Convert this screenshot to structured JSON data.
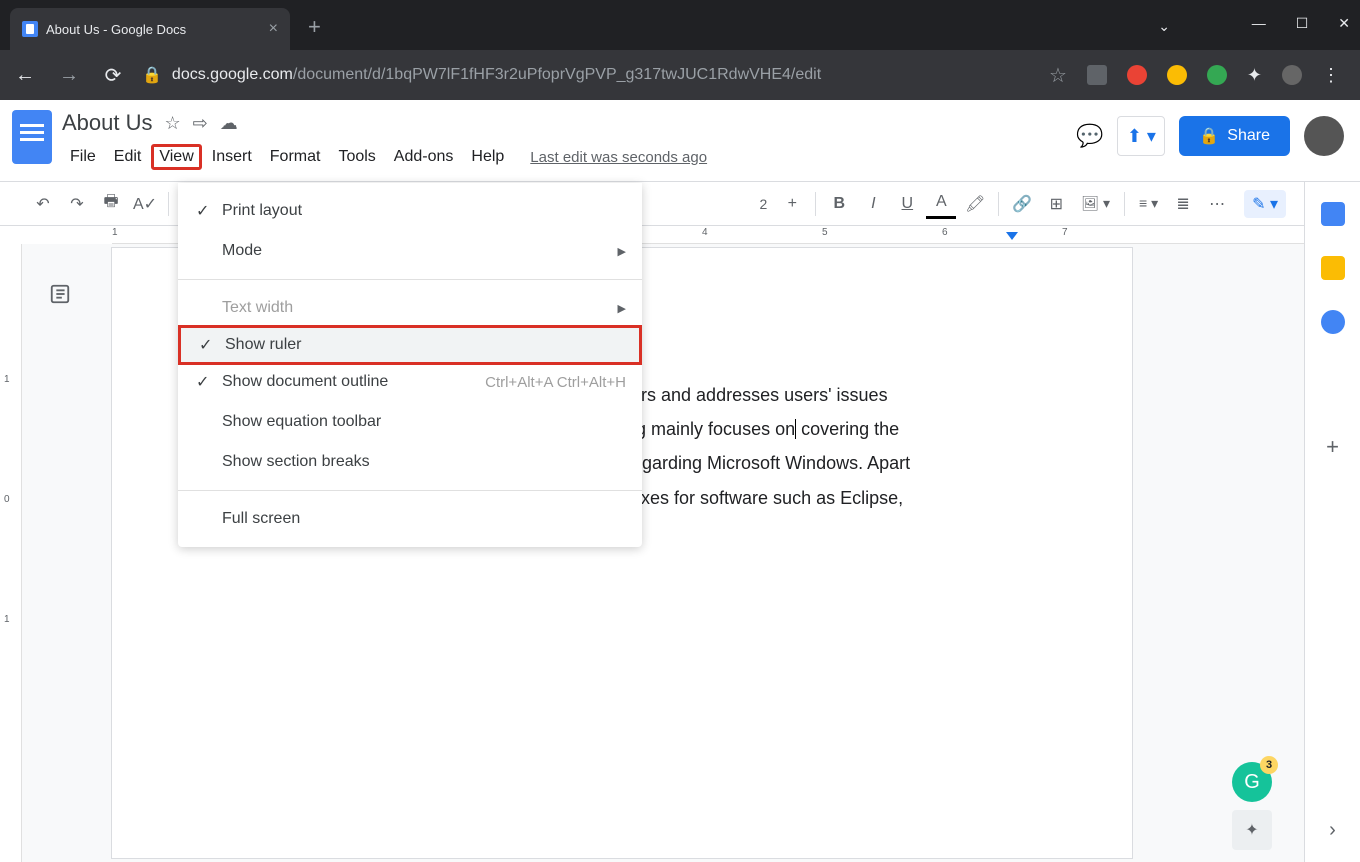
{
  "browser": {
    "tab_title": "About Us - Google Docs",
    "url_domain": "docs.google.com",
    "url_path": "/document/d/1bqPW7lF1fHF3r2uPfoprVgPVP_g317twJUC1RdwVHE4/edit"
  },
  "docs": {
    "title": "About Us",
    "menus": [
      "File",
      "Edit",
      "View",
      "Insert",
      "Format",
      "Tools",
      "Add-ons",
      "Help"
    ],
    "last_edit": "Last edit was seconds ago",
    "share_label": "Share"
  },
  "toolbar": {
    "zoom_partial": "2"
  },
  "ruler": {
    "h_numbers": [
      "1",
      "4",
      "5",
      "6",
      "7"
    ],
    "v_numbers": [
      "1",
      "0",
      "1"
    ]
  },
  "view_menu": {
    "items": [
      {
        "label": "Print layout",
        "checked": true
      },
      {
        "label": "Mode",
        "submenu": true
      },
      {
        "label": "Text width",
        "submenu": true,
        "disabled": true
      },
      {
        "label": "Show ruler",
        "checked": true,
        "highlighted": true
      },
      {
        "label": "Show document outline",
        "checked": true,
        "shortcut": "Ctrl+Alt+A Ctrl+Alt+H"
      },
      {
        "label": "Show equation toolbar"
      },
      {
        "label": "Show section breaks"
      },
      {
        "label": "Full screen"
      }
    ]
  },
  "document": {
    "body_text": "users and addresses users' issues blog mainly focuses on covering the s regarding Microsoft Windows. Apart nt fixes for software such as Eclipse,"
  },
  "grammarly_count": "3"
}
